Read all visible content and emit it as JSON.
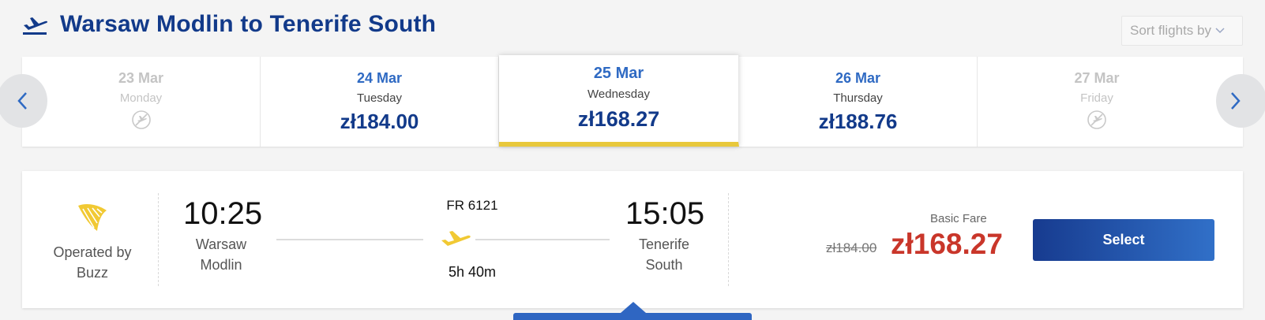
{
  "header": {
    "title": "Warsaw Modlin to Tenerife South",
    "icon": "departing-plane-icon"
  },
  "sort": {
    "label": "Sort flights by",
    "icon": "chevron-down-icon"
  },
  "dates": [
    {
      "date": "23 Mar",
      "weekday": "Monday",
      "price": null,
      "available": false
    },
    {
      "date": "24 Mar",
      "weekday": "Tuesday",
      "price": "zł184.00",
      "available": true
    },
    {
      "date": "25 Mar",
      "weekday": "Wednesday",
      "price": "zł168.27",
      "available": true,
      "selected": true
    },
    {
      "date": "26 Mar",
      "weekday": "Thursday",
      "price": "zł188.76",
      "available": true
    },
    {
      "date": "27 Mar",
      "weekday": "Friday",
      "price": null,
      "available": false
    }
  ],
  "flight": {
    "operated_by": "Operated by",
    "operator": "Buzz",
    "depart_time": "10:25",
    "depart_city_line1": "Warsaw",
    "depart_city_line2": "Modlin",
    "flight_number": "FR 6121",
    "duration": "5h 40m",
    "arrive_time": "15:05",
    "arrive_city_line1": "Tenerife",
    "arrive_city_line2": "South",
    "fare_type": "Basic Fare",
    "original_price": "zł184.00",
    "price": "zł168.27",
    "select_label": "Select"
  },
  "colors": {
    "brand_blue": "#123a8a",
    "accent_blue": "#2f6ac3",
    "highlight_yellow": "#e8c83c",
    "price_red": "#c9362a"
  }
}
